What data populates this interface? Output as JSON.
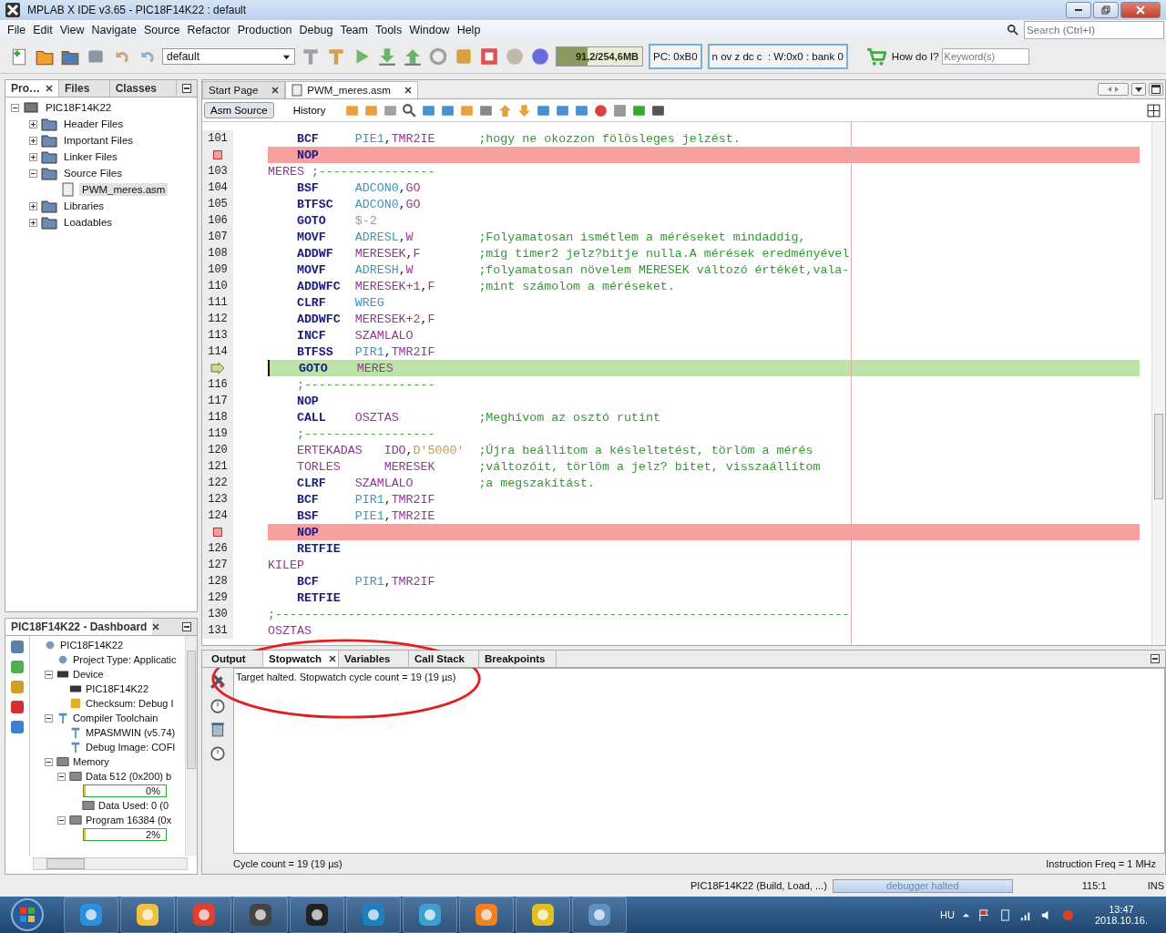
{
  "window": {
    "title": "MPLAB X IDE v3.65 - PIC18F14K22 : default"
  },
  "menu": [
    "File",
    "Edit",
    "View",
    "Navigate",
    "Source",
    "Refactor",
    "Production",
    "Debug",
    "Team",
    "Tools",
    "Window",
    "Help"
  ],
  "search": {
    "placeholder": "Search (Ctrl+I)"
  },
  "toolbar": {
    "config": "default",
    "memory": {
      "text": "91,2/254,6MB",
      "level": 0.36
    },
    "pc": "PC: 0xB0",
    "status": "n ov z dc c  : W:0x0 : bank 0",
    "howdoi": "How do I?",
    "keyword_placeholder": "Keyword(s)"
  },
  "project_panel": {
    "tabs": [
      {
        "label": "Pro…",
        "selected": true
      },
      {
        "label": "Files",
        "selected": false
      },
      {
        "label": "Classes",
        "selected": false
      }
    ],
    "tree": [
      {
        "label": "PIC18F14K22",
        "expanded": true,
        "selected": false,
        "children": [
          {
            "label": "Header Files",
            "expanded": false,
            "selected": false
          },
          {
            "label": "Important Files",
            "expanded": false,
            "selected": false
          },
          {
            "label": "Linker Files",
            "expanded": false,
            "selected": false
          },
          {
            "label": "Source Files",
            "expanded": true,
            "selected": false,
            "children": [
              {
                "label": "PWM_meres.asm",
                "selected": true
              }
            ]
          },
          {
            "label": "Libraries",
            "expanded": false,
            "selected": false
          },
          {
            "label": "Loadables",
            "expanded": false,
            "selected": false
          }
        ]
      }
    ]
  },
  "dashboard": {
    "title": "PIC18F14K22 - Dashboard",
    "tree": [
      {
        "kind": "node",
        "label": "PIC18F14K22",
        "children": [
          {
            "kind": "node",
            "label": "Project Type: Applicatic"
          },
          {
            "kind": "node",
            "label": "Device",
            "expanded": true,
            "children": [
              {
                "kind": "node",
                "label": "PIC18F14K22"
              },
              {
                "kind": "node",
                "label": "Checksum: Debug I"
              }
            ]
          },
          {
            "kind": "node",
            "label": "Compiler Toolchain",
            "expanded": true,
            "children": [
              {
                "kind": "node",
                "label": "MPASMWIN (v5.74)"
              },
              {
                "kind": "node",
                "label": "Debug Image: COFI"
              }
            ]
          },
          {
            "kind": "node",
            "label": "Memory",
            "expanded": true,
            "children": [
              {
                "kind": "node",
                "label": "Data 512 (0x200) b",
                "expanded": true,
                "children": [
                  {
                    "kind": "progress",
                    "text": "0%",
                    "level": 0
                  },
                  {
                    "kind": "node",
                    "label": "Data Used: 0 (0"
                  }
                ]
              },
              {
                "kind": "node",
                "label": "Program 16384 (0x",
                "expanded": true,
                "children": [
                  {
                    "kind": "progress",
                    "text": "2%",
                    "level": 0.02
                  }
                ]
              }
            ]
          }
        ]
      }
    ]
  },
  "editor": {
    "tabs": [
      {
        "label": "Start Page",
        "selected": false
      },
      {
        "label": "PWM_meres.asm",
        "selected": true
      }
    ],
    "views": [
      {
        "label": "Asm Source",
        "selected": true
      },
      {
        "label": "History",
        "selected": false
      }
    ],
    "lines": [
      {
        "number": "101",
        "breakpoint": false,
        "current": false,
        "kind": "instr",
        "op": "BCF",
        "args": [
          {
            "text": "PIE1",
            "kind": "reg"
          },
          {
            "text": ",",
            "kind": "punct"
          },
          {
            "text": "TMR2IE",
            "kind": "var"
          }
        ],
        "comment": ";hogy ne okozzon fölösleges jelzést."
      },
      {
        "breakpoint": true,
        "current": false,
        "kind": "instr",
        "op": "NOP"
      },
      {
        "number": "103",
        "breakpoint": false,
        "current": false,
        "kind": "label",
        "label": "MERES",
        "comment": ";----------------"
      },
      {
        "number": "104",
        "breakpoint": false,
        "current": false,
        "kind": "instr",
        "op": "BSF",
        "args": [
          {
            "text": "ADCON0",
            "kind": "reg"
          },
          {
            "text": ",",
            "kind": "punct"
          },
          {
            "text": "GO",
            "kind": "var"
          }
        ]
      },
      {
        "number": "105",
        "breakpoint": false,
        "current": false,
        "kind": "instr",
        "op": "BTFSC",
        "args": [
          {
            "text": "ADCON0",
            "kind": "reg"
          },
          {
            "text": ",",
            "kind": "punct"
          },
          {
            "text": "GO",
            "kind": "var"
          }
        ]
      },
      {
        "number": "106",
        "breakpoint": false,
        "current": false,
        "kind": "instr",
        "op": "GOTO",
        "args": [
          {
            "text": "$-2",
            "kind": "num"
          }
        ]
      },
      {
        "number": "107",
        "breakpoint": false,
        "current": false,
        "kind": "instr",
        "op": "MOVF",
        "args": [
          {
            "text": "ADRESL",
            "kind": "reg"
          },
          {
            "text": ",",
            "kind": "punct"
          },
          {
            "text": "W",
            "kind": "var"
          }
        ],
        "comment": ";Folyamatosan ismétlem a méréseket mindaddig,"
      },
      {
        "number": "108",
        "breakpoint": false,
        "current": false,
        "kind": "instr",
        "op": "ADDWF",
        "args": [
          {
            "text": "MERESEK",
            "kind": "var"
          },
          {
            "text": ",",
            "kind": "punct"
          },
          {
            "text": "F",
            "kind": "var"
          }
        ],
        "comment": ";míg timer2 jelz?bitje nulla.A mérések eredményével"
      },
      {
        "number": "109",
        "breakpoint": false,
        "current": false,
        "kind": "instr",
        "op": "MOVF",
        "args": [
          {
            "text": "ADRESH",
            "kind": "reg"
          },
          {
            "text": ",",
            "kind": "punct"
          },
          {
            "text": "W",
            "kind": "var"
          }
        ],
        "comment": ";folyamatosan növelem MERESEK változó értékét,vala-"
      },
      {
        "number": "110",
        "breakpoint": false,
        "current": false,
        "kind": "instr",
        "op": "ADDWFC",
        "args": [
          {
            "text": "MERESEK+1",
            "kind": "var"
          },
          {
            "text": ",",
            "kind": "punct"
          },
          {
            "text": "F",
            "kind": "var"
          }
        ],
        "comment": ";mint számolom a méréseket."
      },
      {
        "number": "111",
        "breakpoint": false,
        "current": false,
        "kind": "instr",
        "op": "CLRF",
        "args": [
          {
            "text": "WREG",
            "kind": "reg"
          }
        ]
      },
      {
        "number": "112",
        "breakpoint": false,
        "current": false,
        "kind": "instr",
        "op": "ADDWFC",
        "args": [
          {
            "text": "MERESEK+2",
            "kind": "var"
          },
          {
            "text": ",",
            "kind": "punct"
          },
          {
            "text": "F",
            "kind": "var"
          }
        ]
      },
      {
        "number": "113",
        "breakpoint": false,
        "current": false,
        "kind": "instr",
        "op": "INCF",
        "args": [
          {
            "text": "SZAMLALO",
            "kind": "var"
          }
        ]
      },
      {
        "number": "114",
        "breakpoint": false,
        "current": false,
        "kind": "instr",
        "op": "BTFSS",
        "args": [
          {
            "text": "PIR1",
            "kind": "reg"
          },
          {
            "text": ",",
            "kind": "punct"
          },
          {
            "text": "TMR2IF",
            "kind": "var"
          }
        ]
      },
      {
        "breakpoint": false,
        "current": true,
        "kind": "instr",
        "op": "GOTO",
        "args": [
          {
            "text": "MERES",
            "kind": "var"
          }
        ]
      },
      {
        "number": "116",
        "breakpoint": false,
        "current": false,
        "kind": "rule",
        "comment": ";------------------"
      },
      {
        "number": "117",
        "breakpoint": false,
        "current": false,
        "kind": "instr",
        "op": "NOP"
      },
      {
        "number": "118",
        "breakpoint": false,
        "current": false,
        "kind": "instr",
        "op": "CALL",
        "args": [
          {
            "text": "OSZTAS",
            "kind": "var"
          }
        ],
        "comment": ";Meghívom az osztó rutint"
      },
      {
        "number": "119",
        "breakpoint": false,
        "current": false,
        "kind": "rule",
        "comment": ";------------------"
      },
      {
        "number": "120",
        "breakpoint": false,
        "current": false,
        "kind": "macro",
        "op": "ERTEKADAS",
        "args": [
          {
            "text": "IDO",
            "kind": "var"
          },
          {
            "text": ",",
            "kind": "punct"
          },
          {
            "text": "D'5000'",
            "kind": "str"
          }
        ],
        "comment": ";Újra beállítom a késleltetést, törlöm a mérés"
      },
      {
        "number": "121",
        "breakpoint": false,
        "current": false,
        "kind": "macro",
        "op": "TORLES",
        "args": [
          {
            "text": "MERESEK",
            "kind": "var"
          }
        ],
        "comment": ";változóit, törlöm a jelz? bitet, visszaállítom"
      },
      {
        "number": "122",
        "breakpoint": false,
        "current": false,
        "kind": "instr",
        "op": "CLRF",
        "args": [
          {
            "text": "SZAMLALO",
            "kind": "var"
          }
        ],
        "comment": ";a megszakítást."
      },
      {
        "number": "123",
        "breakpoint": false,
        "current": false,
        "kind": "instr",
        "op": "BCF",
        "args": [
          {
            "text": "PIR1",
            "kind": "reg"
          },
          {
            "text": ",",
            "kind": "punct"
          },
          {
            "text": "TMR2IF",
            "kind": "var"
          }
        ]
      },
      {
        "number": "124",
        "breakpoint": false,
        "current": false,
        "kind": "instr",
        "op": "BSF",
        "args": [
          {
            "text": "PIE1",
            "kind": "reg"
          },
          {
            "text": ",",
            "kind": "punct"
          },
          {
            "text": "TMR2IE",
            "kind": "var"
          }
        ]
      },
      {
        "breakpoint": true,
        "current": false,
        "kind": "instr",
        "op": "NOP"
      },
      {
        "number": "126",
        "breakpoint": false,
        "current": false,
        "kind": "instr",
        "op": "RETFIE"
      },
      {
        "number": "127",
        "breakpoint": false,
        "current": false,
        "kind": "label",
        "label": "KILEP"
      },
      {
        "number": "128",
        "breakpoint": false,
        "current": false,
        "kind": "instr",
        "op": "BCF",
        "args": [
          {
            "text": "PIR1",
            "kind": "reg"
          },
          {
            "text": ",",
            "kind": "punct"
          },
          {
            "text": "TMR2IF",
            "kind": "var"
          }
        ]
      },
      {
        "number": "129",
        "breakpoint": false,
        "current": false,
        "kind": "instr",
        "op": "RETFIE"
      },
      {
        "number": "130",
        "breakpoint": false,
        "current": false,
        "kind": "label",
        "comment": ";-------------------------------------------------------------------------------"
      },
      {
        "number": "131",
        "breakpoint": false,
        "current": false,
        "kind": "label",
        "label": "OSZTAS"
      }
    ]
  },
  "output": {
    "tabs": [
      {
        "label": "Output",
        "selected": false
      },
      {
        "label": "Stopwatch",
        "selected": true
      },
      {
        "label": "Variables",
        "selected": false
      },
      {
        "label": "Call Stack",
        "selected": false
      },
      {
        "label": "Breakpoints",
        "selected": false
      }
    ],
    "message": "Target halted. Stopwatch cycle count = 19 (19 µs)",
    "cycle_count": "Cycle count = 19 (19 µs)",
    "instruction_freq": "Instruction Freq = 1 MHz"
  },
  "status_bar": {
    "build": "PIC18F14K22 (Build, Load, ...)",
    "progress": {
      "text": "debugger halted",
      "level": 1
    },
    "position": "115:1",
    "mode": "INS"
  },
  "taskbar": {
    "language": "HU",
    "time": "13:47",
    "date": "2018.10.16."
  }
}
